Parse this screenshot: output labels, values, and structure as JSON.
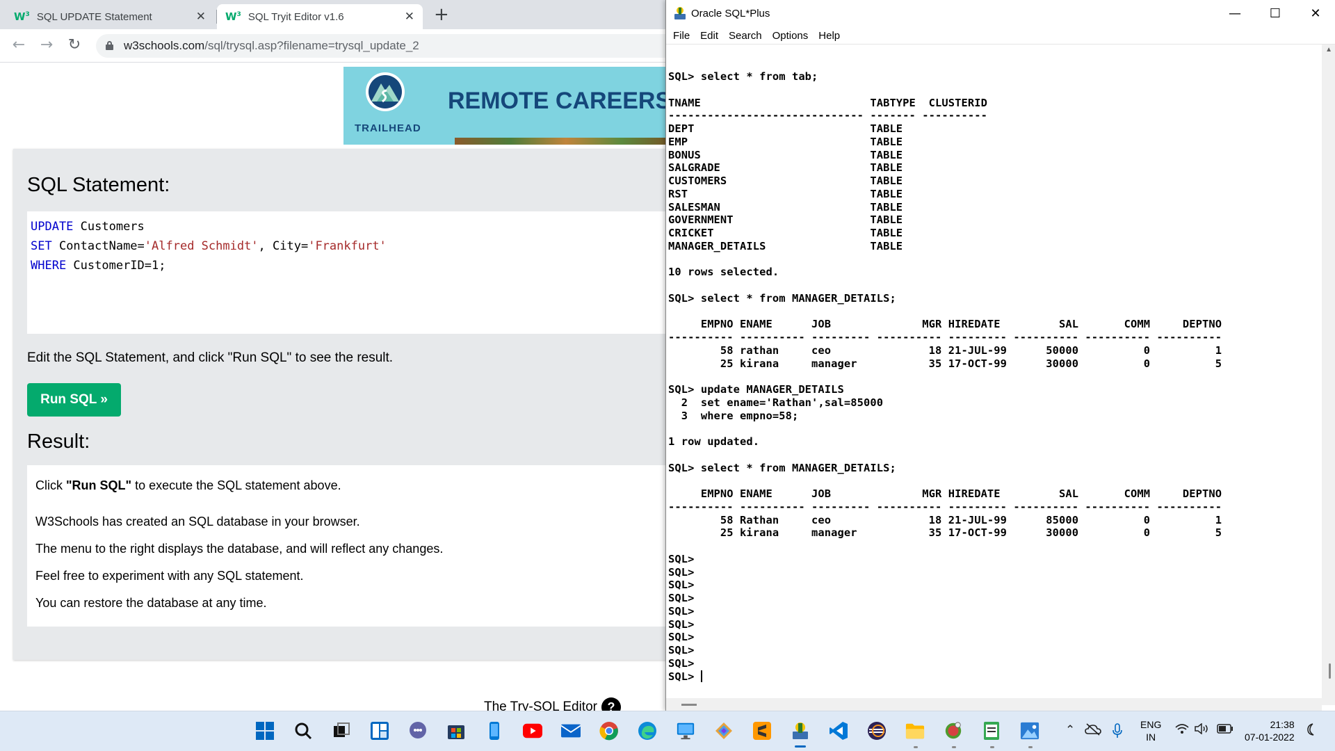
{
  "browser": {
    "tabs": [
      {
        "favicon": "W3",
        "label": "SQL UPDATE Statement",
        "active": false
      },
      {
        "favicon": "W3",
        "label": "SQL Tryit Editor v1.6",
        "active": true
      }
    ],
    "tab_close_glyph": "✕",
    "new_tab_glyph": "+",
    "url_host": "w3schools.com",
    "url_path": "/sql/trysql.asp?filename=trysql_update_2"
  },
  "ad": {
    "brand": "TRAILHEAD",
    "headline": "REMOTE CAREERS S"
  },
  "editor": {
    "statement_heading": "SQL Statement:",
    "code": {
      "line1_kw": "UPDATE",
      "line1_rest": " Customers",
      "line2_kw": "SET",
      "line2_a": " ContactName=",
      "line2_str1": "'Alfred Schmidt'",
      "line2_b": ", City=",
      "line2_str2": "'Frankfurt'",
      "line3_kw": "WHERE",
      "line3_rest": " CustomerID=1;"
    },
    "edit_hint": "Edit the SQL Statement, and click \"Run SQL\" to see the result.",
    "run_button": "Run SQL »",
    "result_heading": "Result:",
    "result_pre": "Click ",
    "result_bold": "\"Run SQL\"",
    "result_post": " to execute the SQL statement above.",
    "info_lines": [
      "W3Schools has created an SQL database in your browser.",
      "The menu to the right displays the database, and will reflect any changes.",
      "Feel free to experiment with any SQL statement.",
      "You can restore the database at any time."
    ],
    "footer": "The Try-SQL Editor",
    "help_glyph": "?"
  },
  "sqlplus": {
    "title": "Oracle SQL*Plus",
    "window_buttons": {
      "minimize": "—",
      "maximize": "☐",
      "close": "✕"
    },
    "menu": [
      "File",
      "Edit",
      "Search",
      "Options",
      "Help"
    ],
    "console_lines": [
      "SQL> select * from tab;",
      "",
      "TNAME                          TABTYPE  CLUSTERID",
      "------------------------------ ------- ----------",
      "DEPT                           TABLE",
      "EMP                            TABLE",
      "BONUS                          TABLE",
      "SALGRADE                       TABLE",
      "CUSTOMERS                      TABLE",
      "RST                            TABLE",
      "SALESMAN                       TABLE",
      "GOVERNMENT                     TABLE",
      "CRICKET                        TABLE",
      "MANAGER_DETAILS                TABLE",
      "",
      "10 rows selected.",
      "",
      "SQL> select * from MANAGER_DETAILS;",
      "",
      "     EMPNO ENAME      JOB              MGR HIREDATE         SAL       COMM     DEPTNO",
      "---------- ---------- --------- ---------- --------- ---------- ---------- ----------",
      "        58 rathan     ceo               18 21-JUL-99      50000          0          1",
      "        25 kirana     manager           35 17-OCT-99      30000          0          5",
      "",
      "SQL> update MANAGER_DETAILS",
      "  2  set ename='Rathan',sal=85000",
      "  3  where empno=58;",
      "",
      "1 row updated.",
      "",
      "SQL> select * from MANAGER_DETAILS;",
      "",
      "     EMPNO ENAME      JOB              MGR HIREDATE         SAL       COMM     DEPTNO",
      "---------- ---------- --------- ---------- --------- ---------- ---------- ----------",
      "        58 Rathan     ceo               18 21-JUL-99      85000          0          1",
      "        25 kirana     manager           35 17-OCT-99      30000          0          5",
      "",
      "SQL>",
      "SQL>",
      "SQL>",
      "SQL>",
      "SQL>",
      "SQL>",
      "SQL>",
      "SQL>",
      "SQL>"
    ],
    "prompt": "SQL> "
  },
  "taskbar": {
    "icons": [
      "windows-start-icon",
      "search-icon",
      "task-view-icon",
      "widgets-icon",
      "teams-chat-icon",
      "store-icon",
      "phone-link-icon",
      "youtube-icon",
      "mail-icon",
      "chrome-icon",
      "edge-icon",
      "remote-desktop-icon",
      "photos-app-icon",
      "sublime-text-icon",
      "sqlplus-icon",
      "vscode-icon",
      "eclipse-icon",
      "file-explorer-icon",
      "git-icon",
      "notepad-icon",
      "image-viewer-icon"
    ],
    "lang_line1": "ENG",
    "lang_line2": "IN",
    "time": "21:38",
    "date": "07-01-2022"
  }
}
